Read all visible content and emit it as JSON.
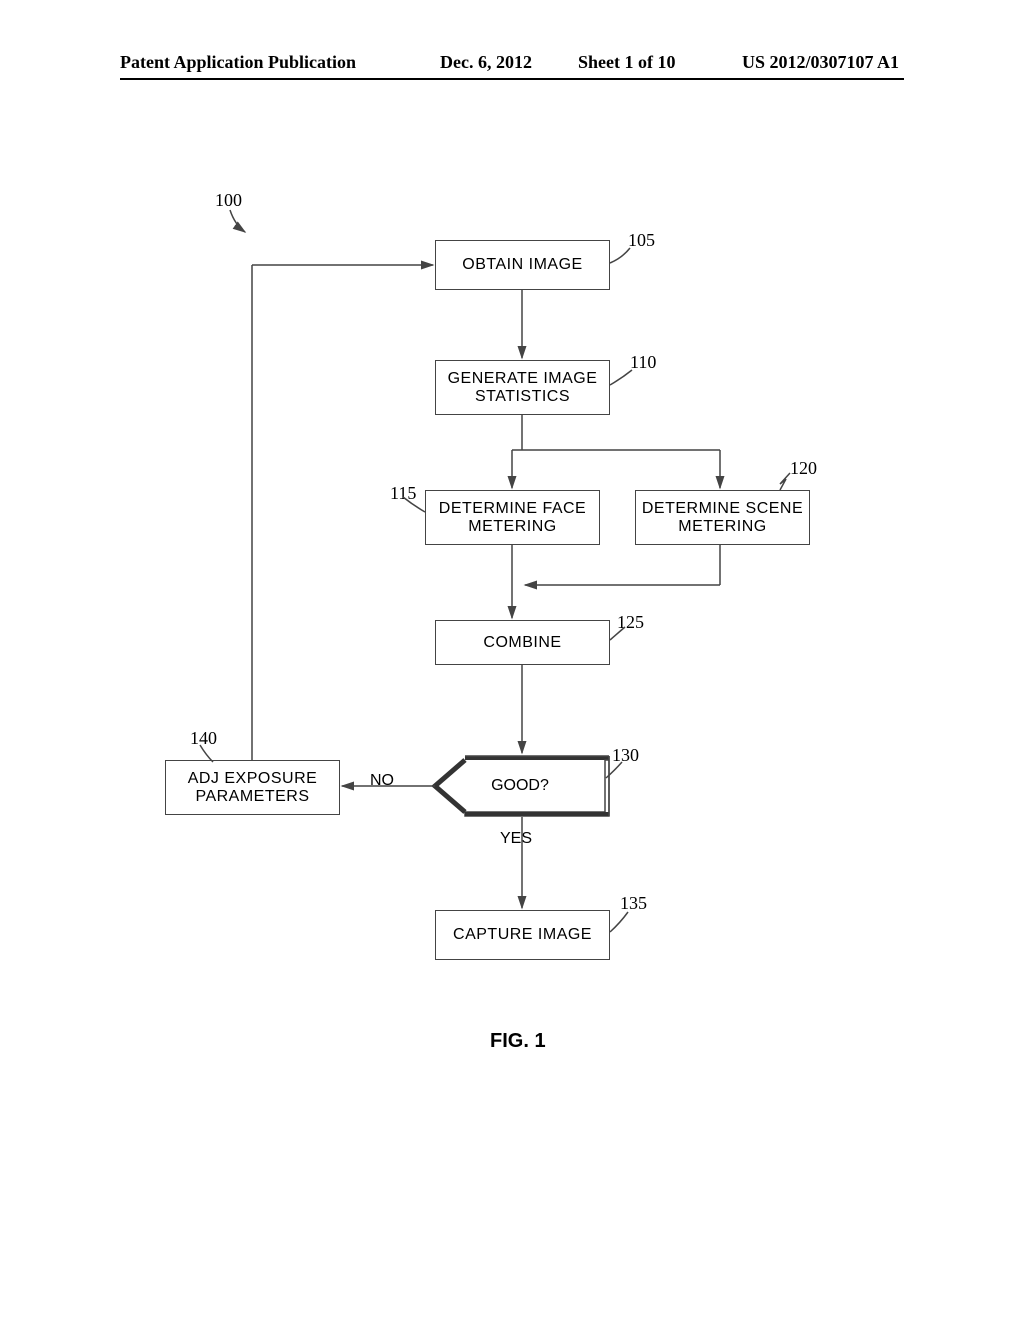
{
  "header": {
    "title": "Patent Application Publication",
    "date": "Dec. 6, 2012",
    "sheet": "Sheet 1 of 10",
    "pubno": "US 2012/0307107 A1"
  },
  "labels": {
    "ref100": "100",
    "ref105": "105",
    "ref110": "110",
    "ref115": "115",
    "ref120": "120",
    "ref125": "125",
    "ref130": "130",
    "ref135": "135",
    "ref140": "140"
  },
  "boxes": {
    "obtain": "OBTAIN IMAGE",
    "generate": "GENERATE IMAGE STATISTICS",
    "face": "DETERMINE FACE METERING",
    "scene": "DETERMINE SCENE METERING",
    "combine": "COMBINE",
    "good": "GOOD?",
    "adj": "ADJ EXPOSURE PARAMETERS",
    "capture": "CAPTURE IMAGE"
  },
  "edges": {
    "no": "NO",
    "yes": "YES"
  },
  "figure": "FIG. 1"
}
